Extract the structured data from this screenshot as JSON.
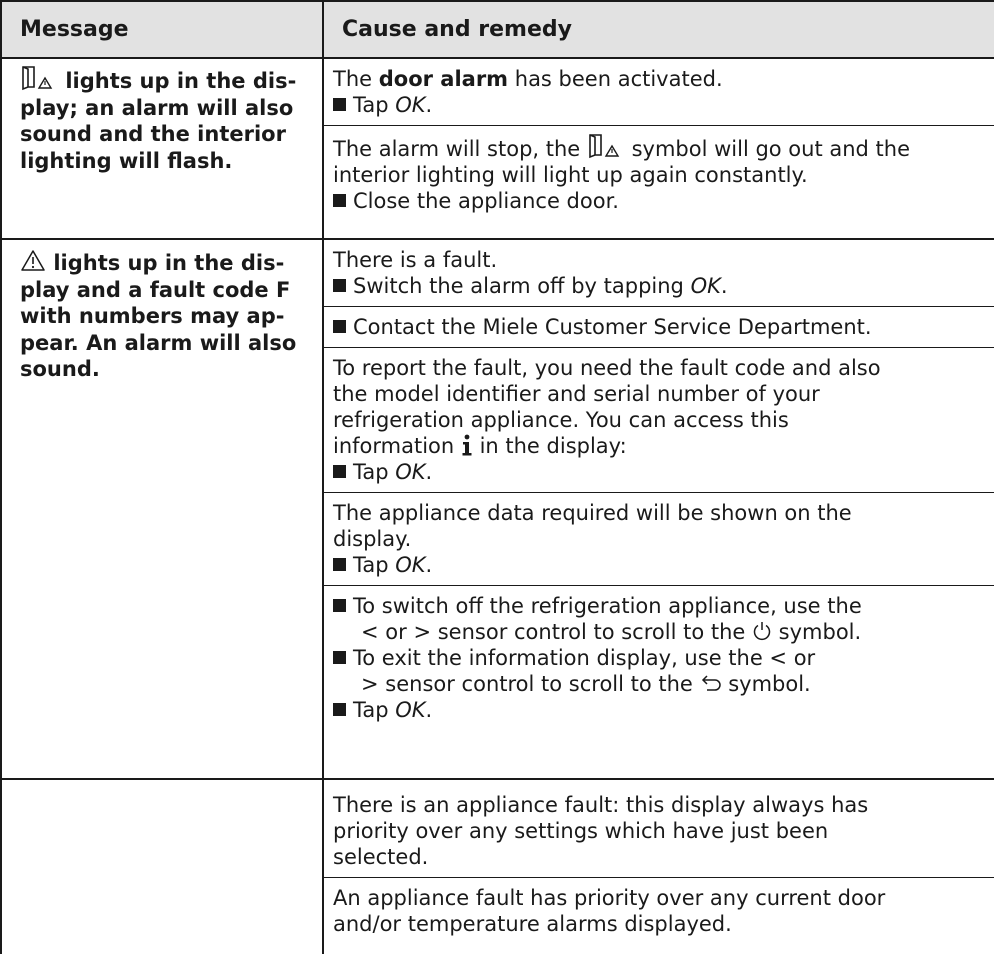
{
  "table": {
    "header": {
      "message": "Message",
      "cause": "Cause and remedy"
    },
    "rows": [
      {
        "message": "lights up in the display; an alarm will also sound and the interior lighting will flash.",
        "message_lines": [
          "lights up in the dis-",
          "play; an alarm will also",
          "sound and the interior",
          "lighting will flash."
        ],
        "message_icon": "door-alarm-icon",
        "cause": {
          "p1_pre": "The ",
          "p1_bold": "door alarm",
          "p1_post": " has been activated.",
          "p1_bullet_pre": "Tap ",
          "p1_bullet_em": "OK",
          "p1_bullet_post": ".",
          "p2_line1_pre": "The alarm will stop, the ",
          "p2_line1_post": " symbol will go out and the",
          "p2_line2": "interior lighting will light up again constantly.",
          "p2_bullet": "Close the appliance door."
        }
      },
      {
        "message_lines": [
          "lights up in the dis-",
          "play and a fault code F",
          "with numbers may ap-",
          "pear. An alarm will also",
          "sound."
        ],
        "message_icon": "warning-triangle-icon",
        "cause": {
          "p1_line": "There is a fault.",
          "p1_bullet_pre": "Switch the alarm off by tapping ",
          "p1_bullet_em": "OK",
          "p1_bullet_post": ".",
          "p2_bullet": "Contact the Miele Customer Service Department.",
          "p3_lines": [
            "To report the fault, you need the fault code and also",
            "the model identifier and serial number of your",
            "refrigeration appliance. You can access this"
          ],
          "p3_info_pre": "information ",
          "p3_info_post": " in the display:",
          "p3_bullet_pre": "Tap ",
          "p3_bullet_em": "OK",
          "p3_bullet_post": ".",
          "p4_line1": "The appliance data required will be shown on the",
          "p4_line2": "display.",
          "p4_b1_pre": "Tap ",
          "p4_b1_em": "OK",
          "p4_b1_post": ".",
          "p5_b1_line1": "To switch off the refrigeration appliance, use the",
          "p5_b1_l2_a": "",
          "p5_b1_l2_b": " or ",
          "p5_b1_l2_c": " sensor control to scroll to the ",
          "p5_b1_l2_d": " symbol.",
          "p5_b2_line1_pre": "To exit the information display, use the ",
          "p5_b2_line1_post": " or",
          "p5_b2_line2_post": " sensor control to scroll to the ",
          "p5_b2_line2_end": " symbol.",
          "p5_b3_pre": "Tap ",
          "p5_b3_em": "OK",
          "p5_b3_post": "."
        }
      },
      {
        "cause": {
          "p1_lines": [
            "There is an appliance fault: this display always has",
            "priority over any settings which have just been",
            "selected."
          ],
          "p2_lines": [
            "An appliance fault has priority over any current door",
            "and/or temperature alarms displayed."
          ]
        }
      }
    ]
  },
  "glyphs": {
    "lt": "<",
    "gt": ">"
  }
}
